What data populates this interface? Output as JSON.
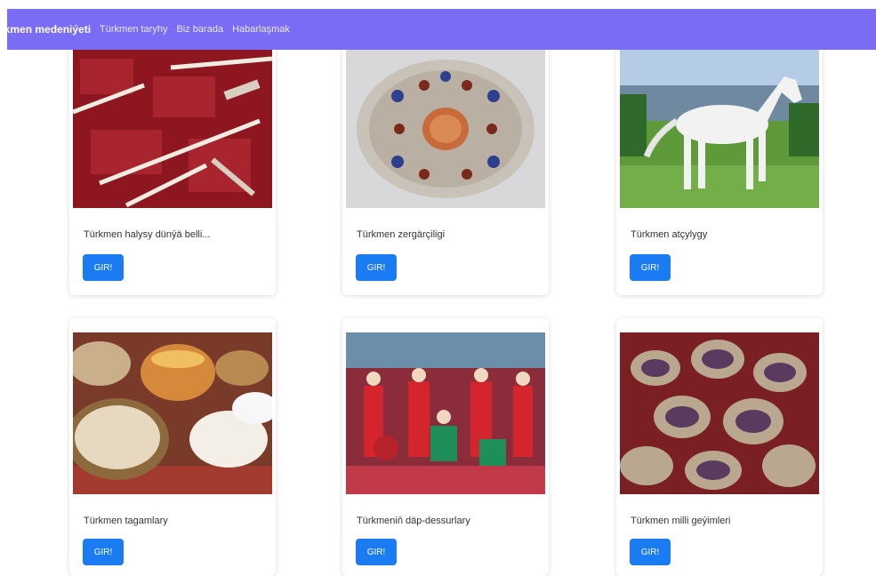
{
  "navbar": {
    "brand": "rkmen medeniýeti",
    "links": [
      "Türkmen taryhy",
      "Biz barada",
      "Habarlaşmak"
    ]
  },
  "cards": [
    {
      "title": "Türkmen halysy dünýä belli...",
      "button": "GIR!",
      "image": "turkmen-carpets-photo"
    },
    {
      "title": "Türkmen zergärçiligi",
      "button": "GIR!",
      "image": "jewelry-brooch-photo"
    },
    {
      "title": "Türkmen atçylygy",
      "button": "GIR!",
      "image": "white-horse-photo"
    },
    {
      "title": "Türkmen tagamlary",
      "button": "GIR!",
      "image": "turkmen-food-photo"
    },
    {
      "title": "Türkmeniň däp-dessurlary",
      "button": "GIR!",
      "image": "traditions-dancers-photo"
    },
    {
      "title": "Türkmen milli geýimleri",
      "button": "GIR!",
      "image": "skullcaps-photo"
    }
  ],
  "colors": {
    "navbar": "#7b6cf6",
    "button": "#1a7bf2"
  }
}
